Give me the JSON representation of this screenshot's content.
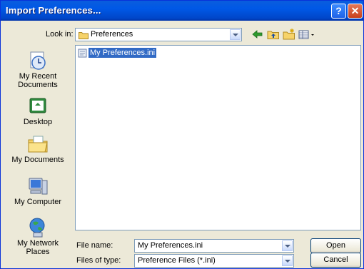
{
  "window": {
    "title": "Import Preferences..."
  },
  "look_in": {
    "label": "Look in:",
    "value": "Preferences"
  },
  "places": [
    {
      "label_line1": "My Recent",
      "label_line2": "Documents"
    },
    {
      "label_line1": "Desktop",
      "label_line2": ""
    },
    {
      "label_line1": "My Documents",
      "label_line2": ""
    },
    {
      "label_line1": "My Computer",
      "label_line2": ""
    },
    {
      "label_line1": "My Network",
      "label_line2": "Places"
    }
  ],
  "files": [
    {
      "name": "My Preferences.ini"
    }
  ],
  "file_name": {
    "label": "File name:",
    "value": "My Preferences.ini"
  },
  "file_type": {
    "label": "Files of type:",
    "value": "Preference Files (*.ini)"
  },
  "buttons": {
    "open": "Open",
    "cancel": "Cancel"
  },
  "colors": {
    "title_bar": "#0055e5",
    "selection": "#316ac5",
    "dialog_bg": "#ece9d8"
  }
}
